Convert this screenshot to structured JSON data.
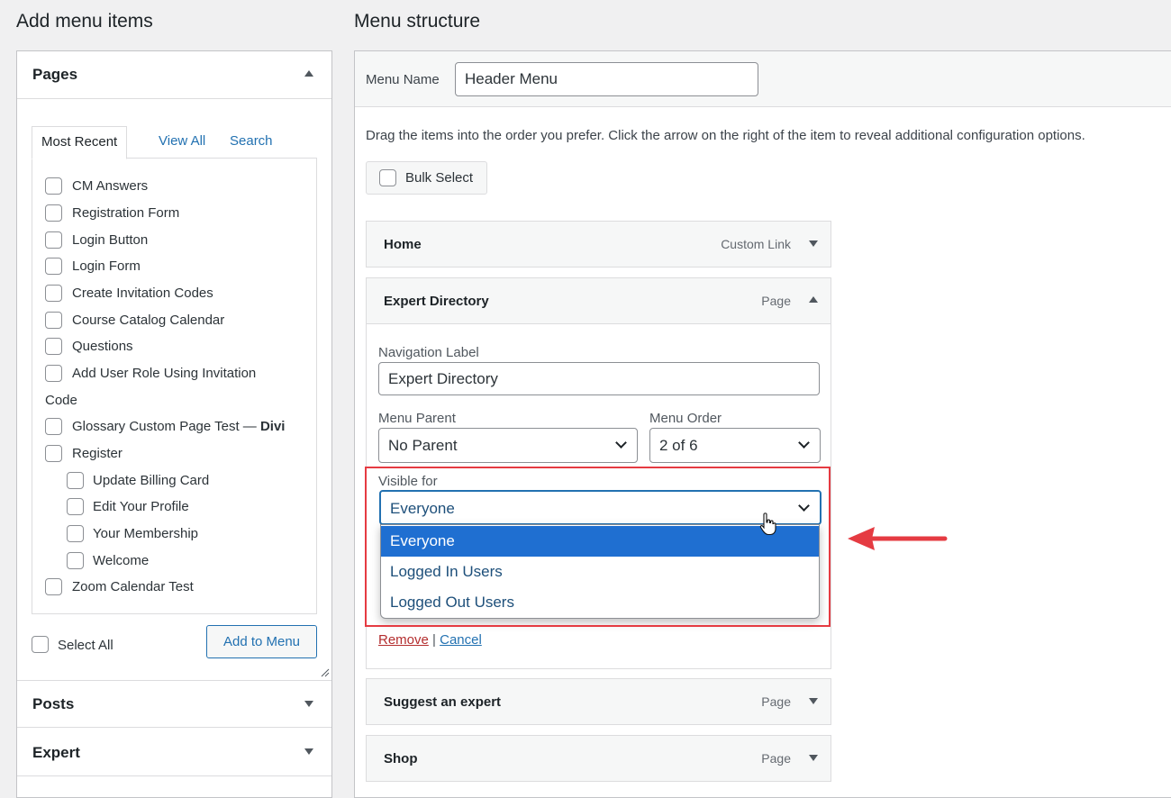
{
  "left_panel": {
    "heading": "Add menu items",
    "pages_section": {
      "title": "Pages",
      "tabs": [
        "Most Recent",
        "View All",
        "Search"
      ],
      "items": [
        {
          "label": "CM Answers"
        },
        {
          "label": "Registration Form"
        },
        {
          "label": "Login Button"
        },
        {
          "label": "Login Form"
        },
        {
          "label": "Create Invitation Codes"
        },
        {
          "label": "Course Catalog Calendar"
        },
        {
          "label": "Questions"
        },
        {
          "label": "Add User Role Using Invitation",
          "label_cont": "Code"
        },
        {
          "label": "Glossary Custom Page Test — ",
          "label_bold": "Divi"
        },
        {
          "label": "Register"
        },
        {
          "label": "Update Billing Card"
        },
        {
          "label": "Edit Your Profile"
        },
        {
          "label": "Your Membership"
        },
        {
          "label": "Welcome"
        },
        {
          "label": "Zoom Calendar Test"
        }
      ],
      "select_all": "Select All",
      "add_button": "Add to Menu"
    },
    "posts_section": {
      "title": "Posts"
    },
    "expert_section": {
      "title": "Expert"
    }
  },
  "right_panel": {
    "heading": "Menu structure",
    "menu_name_label": "Menu Name",
    "menu_name_value": "Header Menu",
    "instructions": "Drag the items into the order you prefer. Click the arrow on the right of the item to reveal additional configuration options.",
    "bulk_select": "Bulk Select",
    "menu_items": [
      {
        "title": "Home",
        "type": "Custom Link"
      },
      {
        "title": "Expert Directory",
        "type": "Page"
      },
      {
        "title": "Suggest an expert",
        "type": "Page"
      },
      {
        "title": "Shop",
        "type": "Page"
      }
    ],
    "settings": {
      "nav_label": "Navigation Label",
      "nav_value": "Expert Directory",
      "parent_label": "Menu Parent",
      "parent_value": "No Parent",
      "order_label": "Menu Order",
      "order_value": "2 of 6",
      "visible_label": "Visible for",
      "visible_value": "Everyone",
      "visible_options": [
        "Everyone",
        "Logged In Users",
        "Logged Out Users"
      ],
      "remove": "Remove",
      "separator": "|",
      "cancel": "Cancel"
    }
  },
  "colors": {
    "highlight_box": "#e53b42",
    "arrow": "#e53b42",
    "link": "#2271b1",
    "selected_option": "#1f6fd1"
  }
}
